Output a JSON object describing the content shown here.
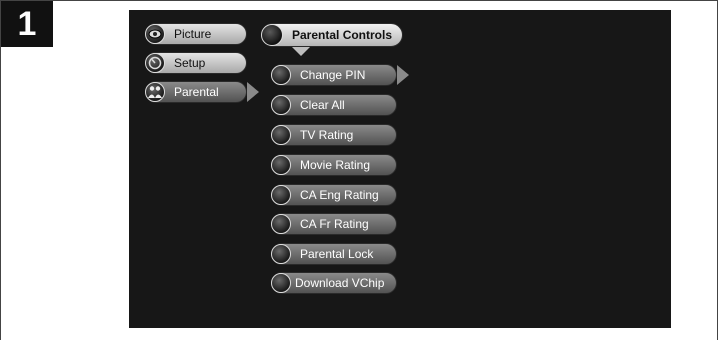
{
  "step_number": "1",
  "main_menu": [
    {
      "label": "Picture",
      "icon": "eye-icon"
    },
    {
      "label": "Setup",
      "icon": "dial-icon"
    },
    {
      "label": "Parental",
      "icon": "family-icon",
      "selected": true
    }
  ],
  "submenu_title": "Parental Controls",
  "submenu_items": [
    {
      "label": "Change PIN",
      "highlighted": true
    },
    {
      "label": "Clear All"
    },
    {
      "label": "TV Rating"
    },
    {
      "label": "Movie Rating"
    },
    {
      "label": "CA Eng Rating"
    },
    {
      "label": "CA Fr Rating"
    },
    {
      "label": "Parental Lock"
    },
    {
      "label": "Download VChip"
    }
  ]
}
